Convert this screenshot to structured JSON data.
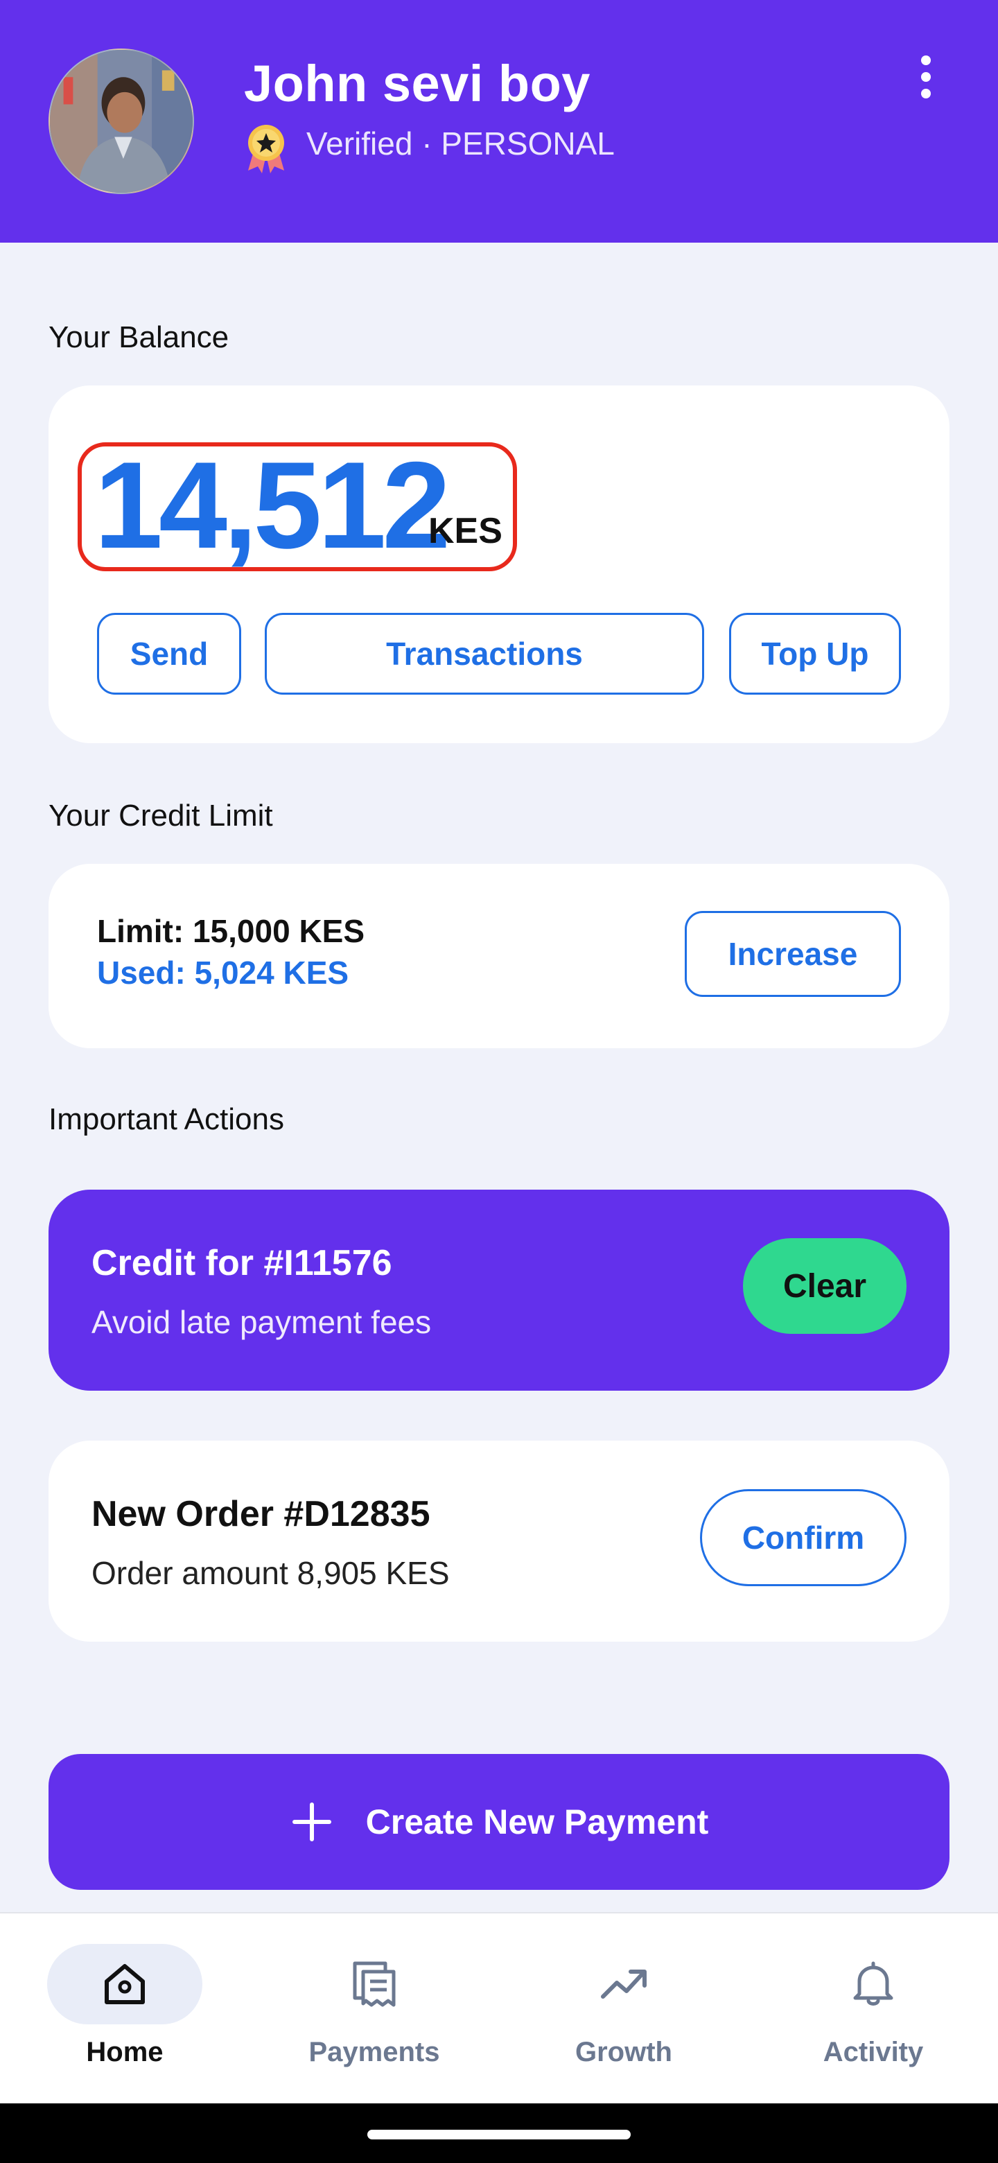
{
  "header": {
    "user_name": "John sevi boy",
    "status": "Verified · PERSONAL",
    "avatar_icon": "user-photo",
    "badge_icon": "verified-ribbon-icon",
    "menu_icon": "more-vertical-icon"
  },
  "balance": {
    "section_label": "Your Balance",
    "value": "14,512",
    "currency": "KES",
    "send_label": "Send",
    "transactions_label": "Transactions",
    "topup_label": "Top Up"
  },
  "credit": {
    "section_label": "Your Credit Limit",
    "limit_text": "Limit: 15,000 KES",
    "used_text": "Used: 5,024 KES",
    "increase_label": "Increase"
  },
  "actions": {
    "section_label": "Important Actions",
    "items": [
      {
        "title": "Credit for #I11576",
        "subtitle": "Avoid late payment fees",
        "button": "Clear"
      },
      {
        "title": "New Order #D12835",
        "subtitle": "Order amount 8,905 KES",
        "button": "Confirm"
      }
    ]
  },
  "create_payment": {
    "label": "Create New Payment",
    "icon": "plus-icon"
  },
  "bottom_nav": {
    "items": [
      {
        "label": "Home",
        "icon": "home-icon",
        "active": true
      },
      {
        "label": "Payments",
        "icon": "receipt-icon",
        "active": false
      },
      {
        "label": "Growth",
        "icon": "trending-up-icon",
        "active": false
      },
      {
        "label": "Activity",
        "icon": "bell-icon",
        "active": false
      }
    ]
  },
  "colors": {
    "primary_purple": "#6330ec",
    "accent_blue": "#1f6fe5",
    "success_green": "#2fd88f",
    "highlight_red": "#e8291c",
    "background": "#f0f2fa"
  }
}
